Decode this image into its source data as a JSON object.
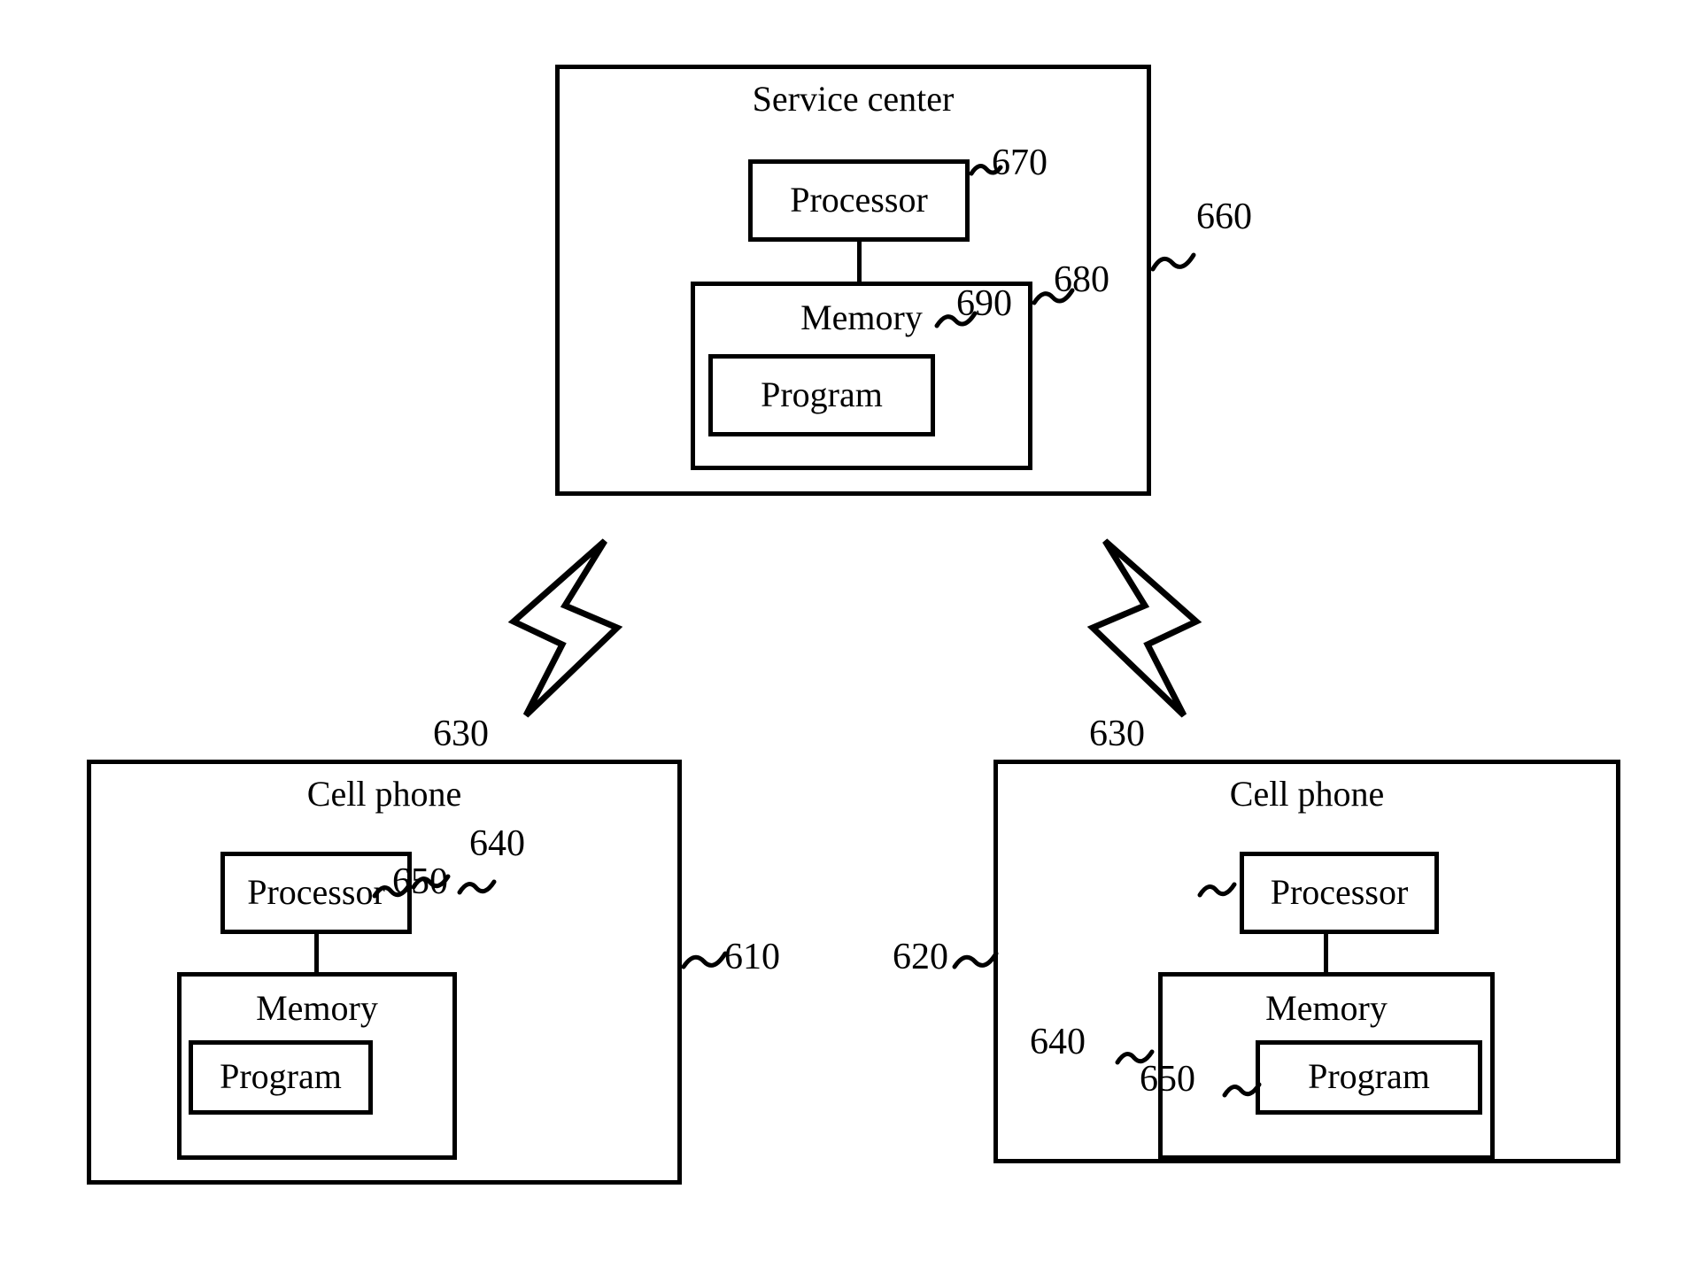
{
  "figure": {
    "kind": "patent-block-diagram",
    "background_color": "#ffffff",
    "line_color": "#000000"
  },
  "service_center": {
    "title": "Service center",
    "ref": "660",
    "processor": {
      "label": "Processor",
      "ref": "670"
    },
    "memory": {
      "label": "Memory",
      "ref": "680",
      "program": {
        "label": "Program",
        "ref": "690"
      }
    }
  },
  "cell_phone_left": {
    "title": "Cell phone",
    "ref": "610",
    "processor": {
      "label": "Processor",
      "ref": "630"
    },
    "memory": {
      "label": "Memory",
      "ref": "640",
      "program": {
        "label": "Program",
        "ref": "650"
      }
    }
  },
  "cell_phone_right": {
    "title": "Cell phone",
    "ref": "620",
    "processor": {
      "label": "Processor",
      "ref": "630"
    },
    "memory": {
      "label": "Memory",
      "ref": "640",
      "program": {
        "label": "Program",
        "ref": "650"
      }
    }
  },
  "links": [
    {
      "name": "wireless-link-left",
      "icon": "lightning-bolt-icon"
    },
    {
      "name": "wireless-link-right",
      "icon": "lightning-bolt-icon"
    }
  ]
}
